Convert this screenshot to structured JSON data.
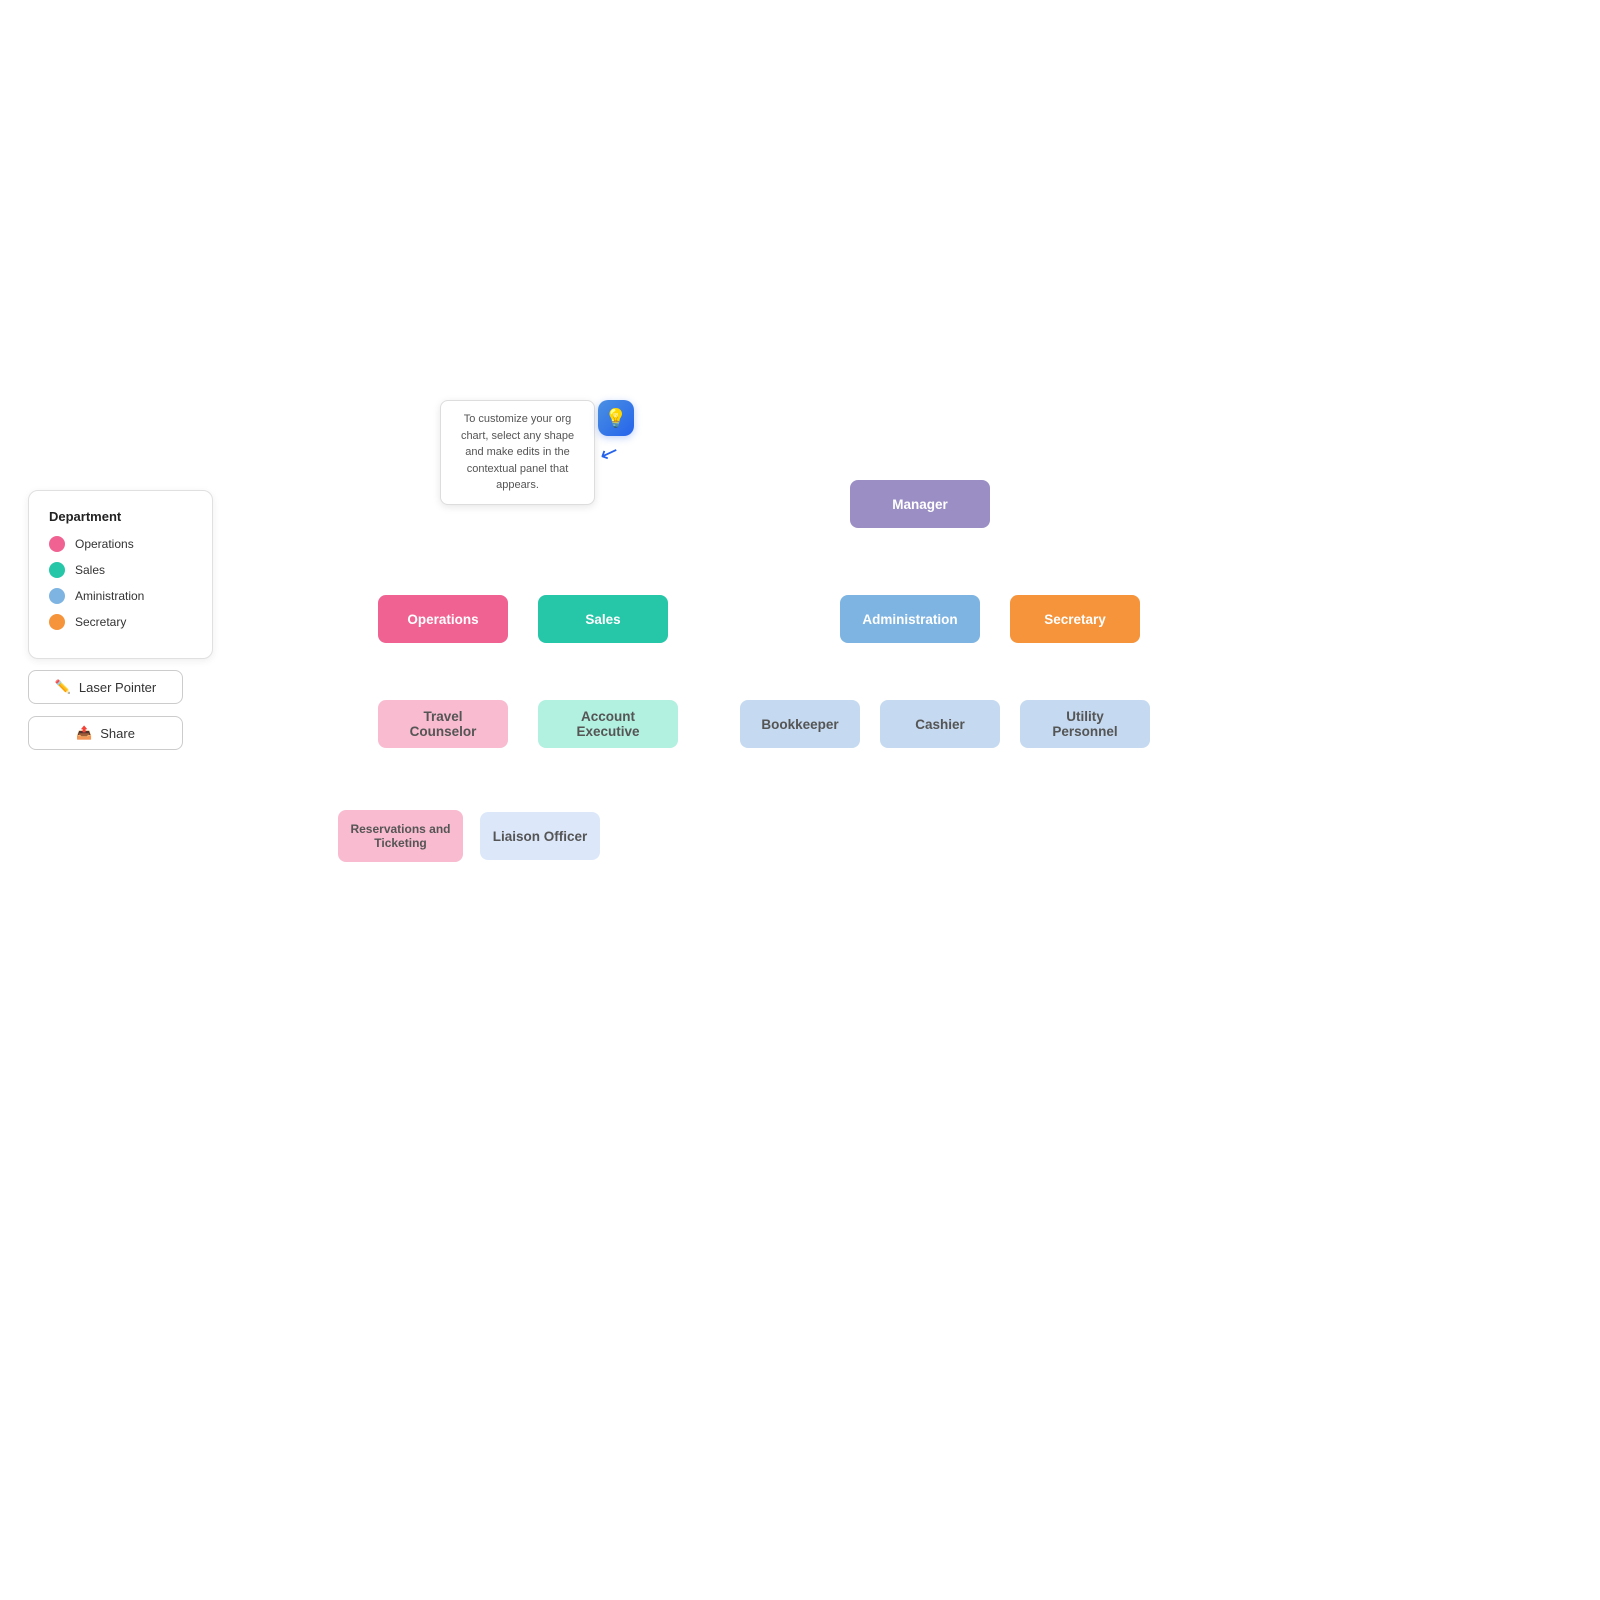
{
  "legend": {
    "title": "Department",
    "items": [
      {
        "label": "Operations",
        "color": "#f06292"
      },
      {
        "label": "Sales",
        "color": "#26c6a8"
      },
      {
        "label": "Aministration",
        "color": "#7eb4e2"
      },
      {
        "label": "Secretary",
        "color": "#f5943a"
      }
    ]
  },
  "buttons": {
    "laser_pointer": "Laser Pointer",
    "share": "Share"
  },
  "tooltip": {
    "text": "To customize your org chart, select any shape and make edits in the contextual panel that appears.",
    "icon": "💡"
  },
  "nodes": {
    "manager": "Manager",
    "operations": "Operations",
    "sales": "Sales",
    "administration": "Administration",
    "secretary": "Secretary",
    "travel_counselor": "Travel Counselor",
    "account_executive": "Account Executive",
    "bookkeeper": "Bookkeeper",
    "cashier": "Cashier",
    "utility_personnel": "Utility Personnel",
    "reservations": "Reservations and Ticketing",
    "liaison": "Liaison Officer"
  }
}
